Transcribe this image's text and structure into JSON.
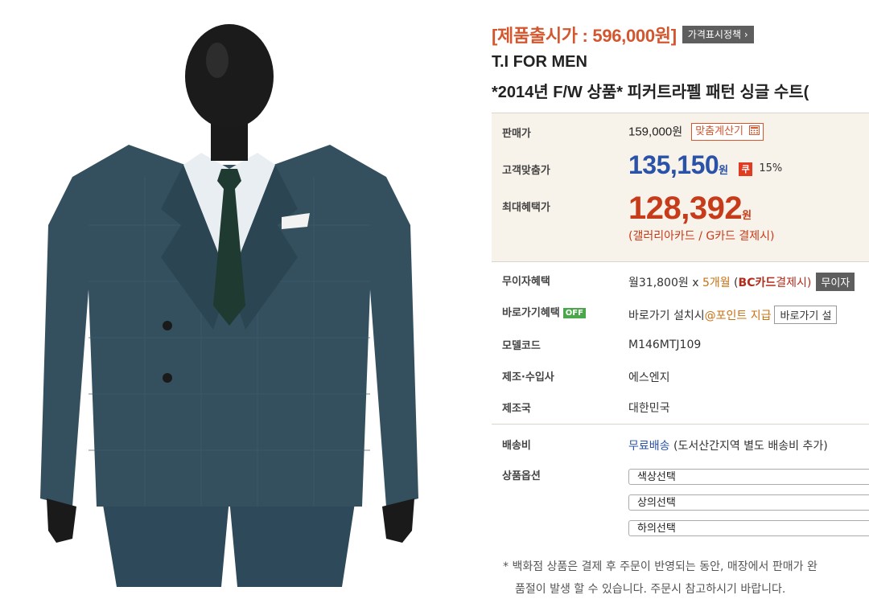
{
  "product": {
    "release_price": "[제품출시가 : 596,000원]",
    "price_policy_button": "가격표시정책 ›",
    "brand": "T.I FOR MEN",
    "title": "*2014년 F/W 상품* 피커트라펠 패턴 싱글 수트("
  },
  "prices": {
    "sale_label": "판매가",
    "sale_price": "159,000",
    "sale_unit": "원",
    "calc_button": "맞춤계산기",
    "customer_label": "고객맞춤가",
    "customer_price": "135,150",
    "customer_unit": "원",
    "coupon_icon_text": "쿠",
    "discount_rate": "15%",
    "max_label": "최대혜택가",
    "max_price": "128,392",
    "max_unit": "원",
    "max_note": "(갤러리아카드 / G카드 결제시)"
  },
  "details": {
    "interest_label": "무이자혜택",
    "interest_monthly": "월31,800원 x ",
    "interest_months": "5개월",
    "interest_open": " (",
    "interest_card": "BC카드",
    "interest_card_suffix": "결제시)",
    "interest_button": "무이자",
    "shortcut_label": "바로가기혜택",
    "shortcut_badge": "OFF",
    "shortcut_text": "바로가기 설치시",
    "shortcut_point": "@포인트 지급",
    "shortcut_button": "바로가기 설",
    "model_label": "모델코드",
    "model_value": "M146MTJ109",
    "maker_label": "제조·수입사",
    "maker_value": "에스엔지",
    "country_label": "제조국",
    "country_value": "대한민국",
    "shipping_label": "배송비",
    "shipping_free": "무료배송",
    "shipping_note": " (도서산간지역 별도 배송비 추가)",
    "options_label": "상품옵션",
    "options": [
      "색상선택",
      "상의선택",
      "하의선택"
    ]
  },
  "notice": {
    "line1": "* 백화점 상품은 결제 후 주문이 반영되는 동안, 매장에서 판매가 완",
    "line2": "품절이 발생 할 수 있습니다. 주문시 참고하시기 바랍니다."
  },
  "colors": {
    "release_price": "#d3562e",
    "customer_price": "#2a52a8",
    "max_price": "#c63b1a",
    "price_box_bg": "#f8f3ea",
    "suit": "#2e4a5a"
  },
  "icons": [
    "calculator-icon",
    "coupon-icon"
  ]
}
